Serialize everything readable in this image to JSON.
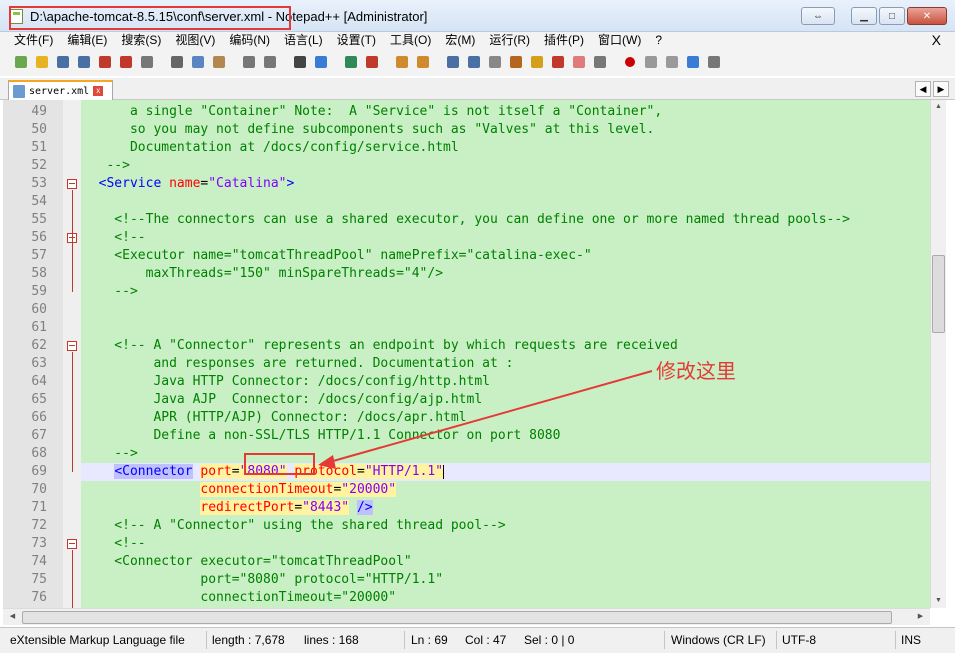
{
  "window": {
    "title": "D:\\apache-tomcat-8.5.15\\conf\\server.xml - Notepad++ [Administrator]"
  },
  "menu": [
    "文件(F)",
    "编辑(E)",
    "搜索(S)",
    "视图(V)",
    "编码(N)",
    "语言(L)",
    "设置(T)",
    "工具(O)",
    "宏(M)",
    "运行(R)",
    "插件(P)",
    "窗口(W)",
    "?"
  ],
  "menu_close": "X",
  "toolbar_icons": [
    "new-file-icon",
    "open-file-icon",
    "save-icon",
    "save-all-icon",
    "close-icon",
    "close-all-icon",
    "print-icon",
    "cut-icon",
    "copy-icon",
    "paste-icon",
    "undo-icon",
    "redo-icon",
    "find-icon",
    "replace-icon",
    "zoom-in-icon",
    "zoom-out-icon",
    "sync-v-icon",
    "sync-h-icon",
    "word-wrap-icon",
    "show-all-chars-icon",
    "indent-guide-icon",
    "udl-icon",
    "doc-map-icon",
    "function-list-icon",
    "folder-workspace-icon",
    "monitor-icon",
    "record-macro-icon",
    "stop-record-icon",
    "play-macro-icon",
    "run-macro-multiple-icon",
    "save-macro-icon"
  ],
  "tab": {
    "label": "server.xml",
    "close": "x"
  },
  "annotation": "修改这里",
  "editor_lines": [
    {
      "n": "49",
      "fold": "",
      "parts": [
        {
          "c": "c-cmt",
          "t": "      a single \"Container\" Note:  A \"Service\" is not itself a \"Container\","
        }
      ]
    },
    {
      "n": "50",
      "fold": "",
      "parts": [
        {
          "c": "c-cmt",
          "t": "      so you may not define subcomponents such as \"Valves\" at this level."
        }
      ]
    },
    {
      "n": "51",
      "fold": "",
      "parts": [
        {
          "c": "c-cmt",
          "t": "      Documentation at /docs/config/service.html"
        }
      ]
    },
    {
      "n": "52",
      "fold": "",
      "parts": [
        {
          "c": "c-cmt",
          "t": "   -->"
        }
      ]
    },
    {
      "n": "53",
      "fold": "box",
      "parts": [
        {
          "c": "c-tag",
          "t": "  <Service "
        },
        {
          "c": "c-attr",
          "t": "name"
        },
        {
          "c": "c-txt",
          "t": "="
        },
        {
          "c": "c-val",
          "t": "\"Catalina\""
        },
        {
          "c": "c-tag",
          "t": ">"
        }
      ]
    },
    {
      "n": "54",
      "fold": "",
      "parts": []
    },
    {
      "n": "55",
      "fold": "",
      "parts": [
        {
          "c": "c-cmt",
          "t": "    <!--The connectors can use a shared executor, you can define one or more named thread pools-->"
        }
      ]
    },
    {
      "n": "56",
      "fold": "box",
      "parts": [
        {
          "c": "c-cmt",
          "t": "    <!--"
        }
      ]
    },
    {
      "n": "57",
      "fold": "",
      "parts": [
        {
          "c": "c-cmt",
          "t": "    <Executor name=\"tomcatThreadPool\" namePrefix=\"catalina-exec-\""
        }
      ]
    },
    {
      "n": "58",
      "fold": "",
      "parts": [
        {
          "c": "c-cmt",
          "t": "        maxThreads=\"150\" minSpareThreads=\"4\"/>"
        }
      ]
    },
    {
      "n": "59",
      "fold": "",
      "parts": [
        {
          "c": "c-cmt",
          "t": "    -->"
        }
      ]
    },
    {
      "n": "60",
      "fold": "",
      "parts": []
    },
    {
      "n": "61",
      "fold": "",
      "parts": []
    },
    {
      "n": "62",
      "fold": "box",
      "parts": [
        {
          "c": "c-cmt",
          "t": "    <!-- A \"Connector\" represents an endpoint by which requests are received"
        }
      ]
    },
    {
      "n": "63",
      "fold": "",
      "parts": [
        {
          "c": "c-cmt",
          "t": "         and responses are returned. Documentation at :"
        }
      ]
    },
    {
      "n": "64",
      "fold": "",
      "parts": [
        {
          "c": "c-cmt",
          "t": "         Java HTTP Connector: /docs/config/http.html"
        }
      ]
    },
    {
      "n": "65",
      "fold": "",
      "parts": [
        {
          "c": "c-cmt",
          "t": "         Java AJP  Connector: /docs/config/ajp.html"
        }
      ]
    },
    {
      "n": "66",
      "fold": "",
      "parts": [
        {
          "c": "c-cmt",
          "t": "         APR (HTTP/AJP) Connector: /docs/apr.html"
        }
      ]
    },
    {
      "n": "67",
      "fold": "",
      "parts": [
        {
          "c": "c-cmt",
          "t": "         Define a non-SSL/TLS HTTP/1.1 Connector on port 8080"
        }
      ]
    },
    {
      "n": "68",
      "fold": "",
      "parts": [
        {
          "c": "c-cmt",
          "t": "    -->"
        }
      ]
    },
    {
      "n": "69",
      "fold": "",
      "hl": true,
      "parts": [
        {
          "c": "c-txt",
          "t": "    "
        },
        {
          "c": "c-tag tagmatch",
          "t": "<Connector"
        },
        {
          "c": "c-txt",
          "t": " "
        },
        {
          "c": "c-attr attrbg",
          "t": "port"
        },
        {
          "c": "c-txt attrbg",
          "t": "="
        },
        {
          "c": "c-val attrbg",
          "t": "\"8080\""
        },
        {
          "c": "c-txt",
          "t": " "
        },
        {
          "c": "c-attr attrbg",
          "t": "protocol"
        },
        {
          "c": "c-txt attrbg",
          "t": "="
        },
        {
          "c": "c-val attrbg",
          "t": "\"HTTP/1.1\""
        }
      ]
    },
    {
      "n": "70",
      "fold": "",
      "parts": [
        {
          "c": "c-txt",
          "t": "               "
        },
        {
          "c": "c-attr attrbg",
          "t": "connectionTimeout"
        },
        {
          "c": "c-txt attrbg",
          "t": "="
        },
        {
          "c": "c-val attrbg",
          "t": "\"20000\""
        }
      ]
    },
    {
      "n": "71",
      "fold": "",
      "parts": [
        {
          "c": "c-txt",
          "t": "               "
        },
        {
          "c": "c-attr attrbg",
          "t": "redirectPort"
        },
        {
          "c": "c-txt attrbg",
          "t": "="
        },
        {
          "c": "c-val attrbg",
          "t": "\"8443\""
        },
        {
          "c": "c-txt",
          "t": " "
        },
        {
          "c": "c-tag tagmatch",
          "t": "/>"
        }
      ]
    },
    {
      "n": "72",
      "fold": "",
      "parts": [
        {
          "c": "c-cmt",
          "t": "    <!-- A \"Connector\" using the shared thread pool-->"
        }
      ]
    },
    {
      "n": "73",
      "fold": "box",
      "parts": [
        {
          "c": "c-cmt",
          "t": "    <!--"
        }
      ]
    },
    {
      "n": "74",
      "fold": "",
      "parts": [
        {
          "c": "c-cmt",
          "t": "    <Connector executor=\"tomcatThreadPool\""
        }
      ]
    },
    {
      "n": "75",
      "fold": "",
      "parts": [
        {
          "c": "c-cmt",
          "t": "               port=\"8080\" protocol=\"HTTP/1.1\""
        }
      ]
    },
    {
      "n": "76",
      "fold": "",
      "parts": [
        {
          "c": "c-cmt",
          "t": "               connectionTimeout=\"20000\""
        }
      ]
    }
  ],
  "status": {
    "filetype": "eXtensible Markup Language file",
    "length": "length : 7,678",
    "lines": "lines : 168",
    "ln": "Ln : 69",
    "col": "Col : 47",
    "sel": "Sel : 0 | 0",
    "eol": "Windows (CR LF)",
    "encoding": "UTF-8",
    "mode": "INS"
  }
}
